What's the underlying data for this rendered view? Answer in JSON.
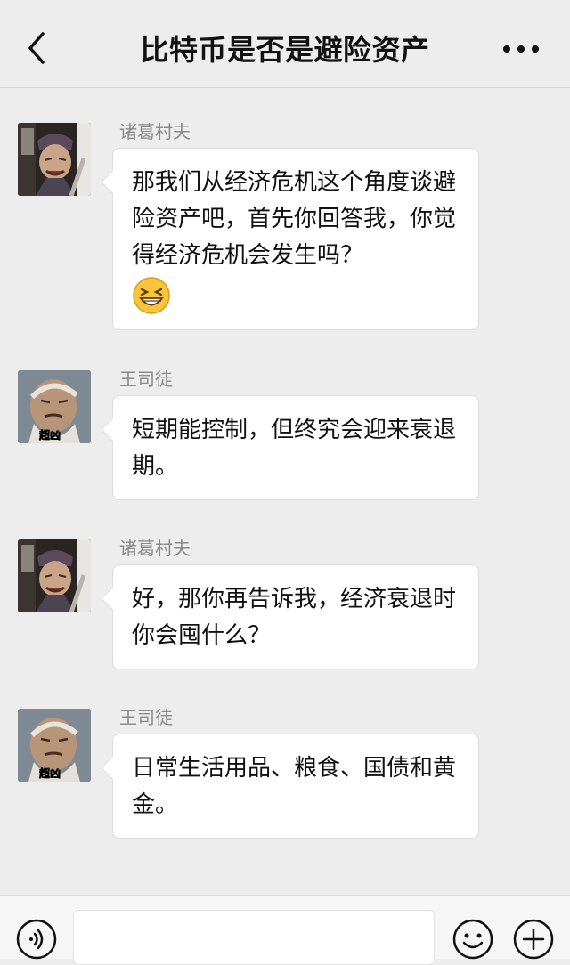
{
  "header": {
    "title": "比特币是否是避险资产",
    "back_icon": "chevron-left-icon",
    "more_icon": "more-dots-icon"
  },
  "messages": [
    {
      "sender": "诸葛村夫",
      "text": "那我们从经济危机这个角度谈避险资产吧，首先你回答我，你觉得经济危机会发生吗？",
      "emoji": "grin-squint-emoji",
      "avatar": "zhuge-avatar"
    },
    {
      "sender": "王司徒",
      "text": "短期能控制，但终究会迎来衰退期。",
      "avatar": "wang-avatar",
      "avatar_caption": "超凶"
    },
    {
      "sender": "诸葛村夫",
      "text": "好，那你再告诉我，经济衰退时你会囤什么？",
      "avatar": "zhuge-avatar"
    },
    {
      "sender": "王司徒",
      "text": "日常生活用品、粮食、国债和黄金。",
      "avatar": "wang-avatar",
      "avatar_caption": "超凶"
    }
  ],
  "input": {
    "value": "",
    "voice_icon": "voice-icon",
    "emoji_icon": "smiley-icon",
    "plus_icon": "plus-icon"
  },
  "colors": {
    "background": "#ededed",
    "bubble": "#ffffff",
    "sender_name": "#8a8a8a",
    "text": "#111111"
  }
}
